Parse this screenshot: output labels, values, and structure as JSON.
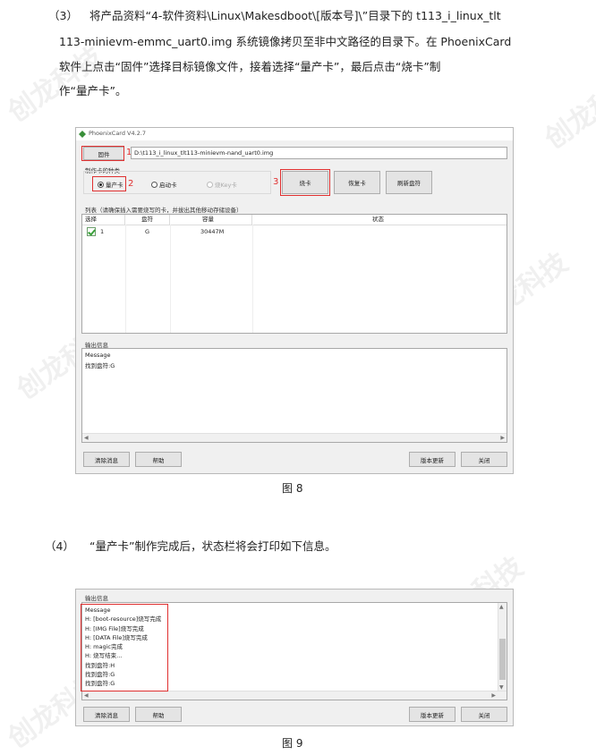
{
  "step3": {
    "number": "（3）",
    "line1": "将产品资料“4-软件资料\\Linux\\Makesdboot\\[版本号]\\”目录下的 t113_i_linux_tlt",
    "line2": "113-minievm-emmc_uart0.img 系统镜像拷贝至非中文路径的目录下。在 PhoenixCard",
    "line3": "软件上点击“固件”选择目标镜像文件，接着选择“量产卡”，最后点击“烧卡”制",
    "line4": "作“量产卡”。"
  },
  "watermark": "创龙科技",
  "app": {
    "title": "PhoenixCard V4.2.7",
    "firmware_button": "固件",
    "firmware_path": "D:\\t113_i_linux_tlt113-minievm-nand_uart0.img",
    "card_type_label": "制作卡的种类",
    "radio_mass": "量产卡",
    "radio_boot": "启动卡",
    "radio_key": "烧Key卡",
    "burn_button": "烧卡",
    "restore_button": "恢复卡",
    "refresh_button": "刷新盘符",
    "list_label": "列表（请确保插入需要烧写的卡，并拔出其他移动存储设备）",
    "columns": [
      "选择",
      "盘符",
      "容量",
      "状态"
    ],
    "rows": [
      {
        "index": "1",
        "drive": "G",
        "capacity": "30447M",
        "status": ""
      }
    ],
    "output_label": "输出信息",
    "log": [
      "Message",
      "找到盘符:G"
    ],
    "clear_button": "清除消息",
    "help_button": "帮助",
    "update_button": "版本更新",
    "close_button": "关闭"
  },
  "annotations": {
    "a1": "1",
    "a2": "2",
    "a3": "3"
  },
  "fig8": "图 8",
  "step4": {
    "number": "（4）",
    "text": "“量产卡”制作完成后，状态栏将会打印如下信息。"
  },
  "app2": {
    "output_label": "输出信息",
    "log": [
      "Message",
      "H: [boot-resource]烧写完成",
      "H: [IMG File]烧写完成",
      "H: [DATA File]烧写完成",
      "H: magic完成",
      "H: 烧写结束...",
      "找到盘符:H",
      "找到盘符:G",
      "找到盘符:G"
    ],
    "clear_button": "清除消息",
    "help_button": "帮助",
    "update_button": "版本更新",
    "close_button": "关闭"
  },
  "fig9": "图 9"
}
